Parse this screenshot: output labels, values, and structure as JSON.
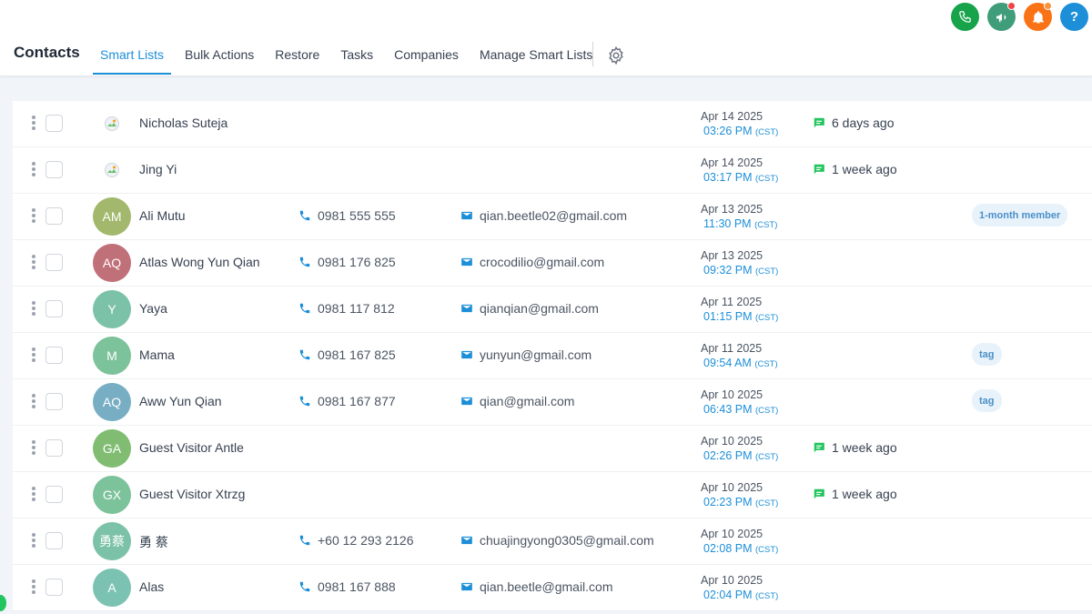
{
  "header": {
    "title": "Contacts",
    "tabs": [
      {
        "label": "Smart Lists",
        "active": true
      },
      {
        "label": "Bulk Actions",
        "active": false
      },
      {
        "label": "Restore",
        "active": false
      },
      {
        "label": "Tasks",
        "active": false
      },
      {
        "label": "Companies",
        "active": false
      },
      {
        "label": "Manage Smart Lists",
        "active": false
      }
    ],
    "settings_icon": "gear-icon",
    "top_icons": [
      {
        "name": "phone-icon",
        "color": "#16a34a"
      },
      {
        "name": "megaphone-icon",
        "color": "#3f9d7a",
        "badge": "red"
      },
      {
        "name": "bell-icon",
        "color": "#f97316",
        "badge": "orange"
      },
      {
        "name": "help-icon",
        "label": "?",
        "color": "#1d8fd8"
      }
    ]
  },
  "colors": {
    "accent": "#1d8fd8",
    "message_icon": "#22c55e",
    "tag_bg": "#e8f2fb",
    "tag_text": "#4a90c8"
  },
  "contacts": [
    {
      "initials": "",
      "avatar_type": "image",
      "name": "Nicholas Suteja",
      "phone": "",
      "email": "",
      "date": "Apr 14 2025",
      "time": "03:26 PM",
      "tz": "(CST)",
      "activity": "6 days ago",
      "tag": ""
    },
    {
      "initials": "",
      "avatar_type": "image",
      "name": "Jing Yi",
      "phone": "",
      "email": "",
      "date": "Apr 14 2025",
      "time": "03:17 PM",
      "tz": "(CST)",
      "activity": "1 week ago",
      "tag": ""
    },
    {
      "initials": "AM",
      "avatar_color": "#a3b86c",
      "name": "Ali Mutu",
      "phone": "0981 555 555",
      "email": "qian.beetle02@gmail.com",
      "date": "Apr 13 2025",
      "time": "11:30 PM",
      "tz": "(CST)",
      "activity": "",
      "tag": "1-month member"
    },
    {
      "initials": "AQ",
      "avatar_color": "#c07078",
      "name": "Atlas Wong Yun Qian",
      "phone": "0981 176 825",
      "email": "crocodilio@gmail.com",
      "date": "Apr 13 2025",
      "time": "09:32 PM",
      "tz": "(CST)",
      "activity": "",
      "tag": ""
    },
    {
      "initials": "Y",
      "avatar_color": "#7cc2a8",
      "name": "Yaya",
      "phone": "0981 117 812",
      "email": "qianqian@gmail.com",
      "date": "Apr 11 2025",
      "time": "01:15 PM",
      "tz": "(CST)",
      "activity": "",
      "tag": ""
    },
    {
      "initials": "M",
      "avatar_color": "#7cc29a",
      "name": "Mama",
      "phone": "0981 167 825",
      "email": "yunyun@gmail.com",
      "date": "Apr 11 2025",
      "time": "09:54 AM",
      "tz": "(CST)",
      "activity": "",
      "tag": "tag"
    },
    {
      "initials": "AQ",
      "avatar_color": "#78aec4",
      "name": "Aww Yun Qian",
      "phone": "0981 167 877",
      "email": "qian@gmail.com",
      "date": "Apr 10 2025",
      "time": "06:43 PM",
      "tz": "(CST)",
      "activity": "",
      "tag": "tag"
    },
    {
      "initials": "GA",
      "avatar_color": "#80bd72",
      "name": "Guest Visitor Antle",
      "phone": "",
      "email": "",
      "date": "Apr 10 2025",
      "time": "02:26 PM",
      "tz": "(CST)",
      "activity": "1 week ago",
      "tag": ""
    },
    {
      "initials": "GX",
      "avatar_color": "#7cc29a",
      "name": "Guest Visitor Xtrzg",
      "phone": "",
      "email": "",
      "date": "Apr 10 2025",
      "time": "02:23 PM",
      "tz": "(CST)",
      "activity": "1 week ago",
      "tag": ""
    },
    {
      "initials": "勇蔡",
      "avatar_color": "#7cc2a8",
      "name": "勇 蔡",
      "phone": "+60 12 293 2126",
      "email": "chuajingyong0305@gmail.com",
      "date": "Apr 10 2025",
      "time": "02:08 PM",
      "tz": "(CST)",
      "activity": "",
      "tag": ""
    },
    {
      "initials": "A",
      "avatar_color": "#7cc2b2",
      "name": "Alas",
      "phone": "0981 167 888",
      "email": "qian.beetle@gmail.com",
      "date": "Apr 10 2025",
      "time": "02:04 PM",
      "tz": "(CST)",
      "activity": "",
      "tag": ""
    }
  ]
}
